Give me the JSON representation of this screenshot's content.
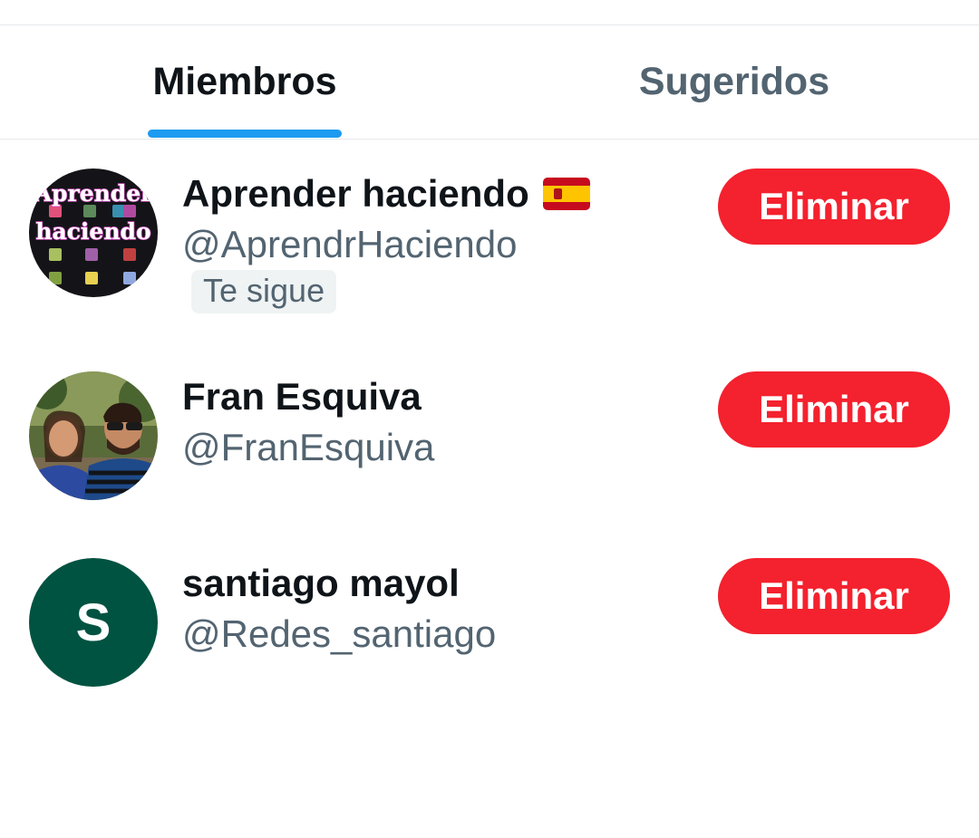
{
  "theme": {
    "accent": "#1d9bf0",
    "danger": "#f4212e",
    "avatar_green": "#005341"
  },
  "tabs": [
    {
      "label": "Miembros",
      "active": true
    },
    {
      "label": "Sugeridos",
      "active": false
    }
  ],
  "members": [
    {
      "name": "Aprender haciendo",
      "name_emoji": "spain-flag-icon",
      "handle": "@AprendrHaciendo",
      "follows_you": "Te sigue",
      "avatar_text_line1": "Aprender",
      "avatar_text_line2": "haciendo",
      "action": "Eliminar"
    },
    {
      "name": "Fran Esquiva",
      "handle": "@FranEsquiva",
      "avatar": "photo-avatar",
      "action": "Eliminar"
    },
    {
      "name": "santiago mayol",
      "handle": "@Redes_santiago",
      "avatar_initial": "S",
      "action": "Eliminar"
    }
  ]
}
